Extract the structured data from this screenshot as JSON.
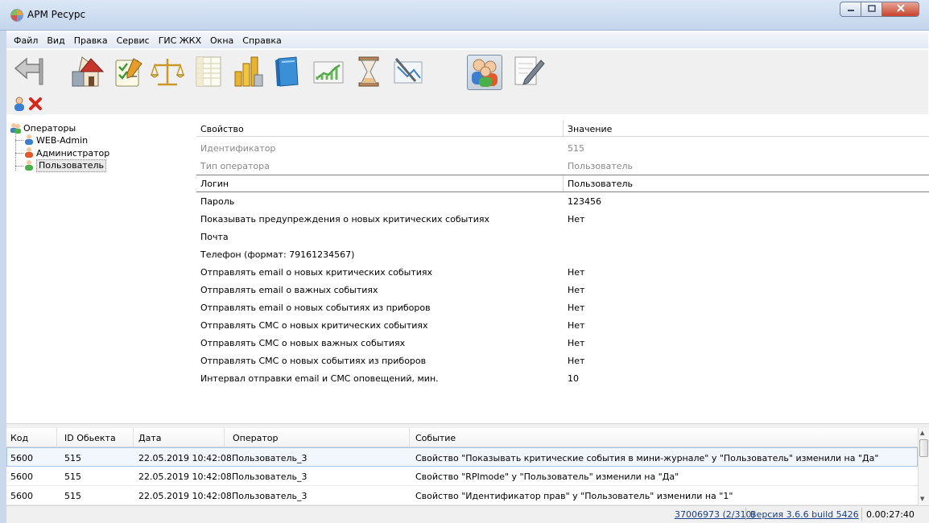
{
  "window": {
    "title": "АРМ Ресурс",
    "min_icon": "minimize-icon",
    "max_icon": "maximize-icon",
    "close_icon": "close-icon"
  },
  "menu": [
    "Файл",
    "Вид",
    "Правка",
    "Сервис",
    "ГИС ЖКХ",
    "Окна",
    "Справка"
  ],
  "toolbar": {
    "buttons": [
      {
        "name": "back-arrow-icon"
      },
      {
        "name": "house-icon"
      },
      {
        "name": "checklist-icon"
      },
      {
        "name": "scales-icon"
      },
      {
        "name": "spreadsheet-icon"
      },
      {
        "name": "bar-chart-icon"
      },
      {
        "name": "book-icon"
      },
      {
        "name": "trend-chart-icon"
      },
      {
        "name": "hourglass-icon"
      },
      {
        "name": "chart-pen-icon"
      },
      {
        "name": "users-icon",
        "active": true
      },
      {
        "name": "edit-document-icon"
      }
    ],
    "small_buttons": [
      {
        "name": "add-user-icon"
      },
      {
        "name": "delete-icon"
      }
    ]
  },
  "tree": {
    "root": "Операторы",
    "children": [
      "WEB-Admin",
      "Администратор",
      "Пользователь"
    ],
    "selected": "Пользователь"
  },
  "properties": {
    "col_property": "Свойство",
    "col_value": "Значение",
    "rows": [
      {
        "name": "Идентификатор",
        "value": "515",
        "readonly": true
      },
      {
        "name": "Тип оператора",
        "value": "Пользователь",
        "readonly": true
      },
      {
        "name": "Логин",
        "value": "Пользователь",
        "selected": true
      },
      {
        "name": "Пароль",
        "value": "123456"
      },
      {
        "name": "Показывать предупреждения о новых критических событиях",
        "value": "Нет"
      },
      {
        "name": "Почта",
        "value": ""
      },
      {
        "name": "Телефон (формат: 79161234567)",
        "value": ""
      },
      {
        "name": "Отправлять email о новых критических событиях",
        "value": "Нет"
      },
      {
        "name": "Отправлять email о важных событиях",
        "value": "Нет"
      },
      {
        "name": "Отправлять email о новых событиях из приборов",
        "value": "Нет"
      },
      {
        "name": "Отправлять СМС о новых критических событиях",
        "value": "Нет"
      },
      {
        "name": "Отправлять СМС о новых важных событиях",
        "value": "Нет"
      },
      {
        "name": "Отправлять СМС о новых событиях из приборов",
        "value": "Нет"
      },
      {
        "name": "Интервал отправки email и СМС оповещений, мин.",
        "value": "10"
      }
    ]
  },
  "events": {
    "columns": [
      "Код",
      "ID Обьекта",
      "Дата",
      "Оператор",
      "Событие"
    ],
    "rows": [
      [
        "5600",
        "515",
        "22.05.2019 10:42:08",
        "Пользователь_3",
        "Свойство \"Показывать критические события в мини-журнале\" у \"Пользователь\" изменили на \"Да\""
      ],
      [
        "5600",
        "515",
        "22.05.2019 10:42:08",
        "Пользователь_3",
        "Свойство \"RPImode\" у \"Пользователь\" изменили на \"Да\""
      ],
      [
        "5600",
        "515",
        "22.05.2019 10:42:08",
        "Пользователь_3",
        "Свойство \"Идентификатор прав\" у \"Пользователь\" изменили на \"1\""
      ]
    ]
  },
  "status": {
    "counter": "37006973 (2/310)",
    "version": "Версия 3.6.6 build 5426",
    "time": "0.00:27:40"
  }
}
